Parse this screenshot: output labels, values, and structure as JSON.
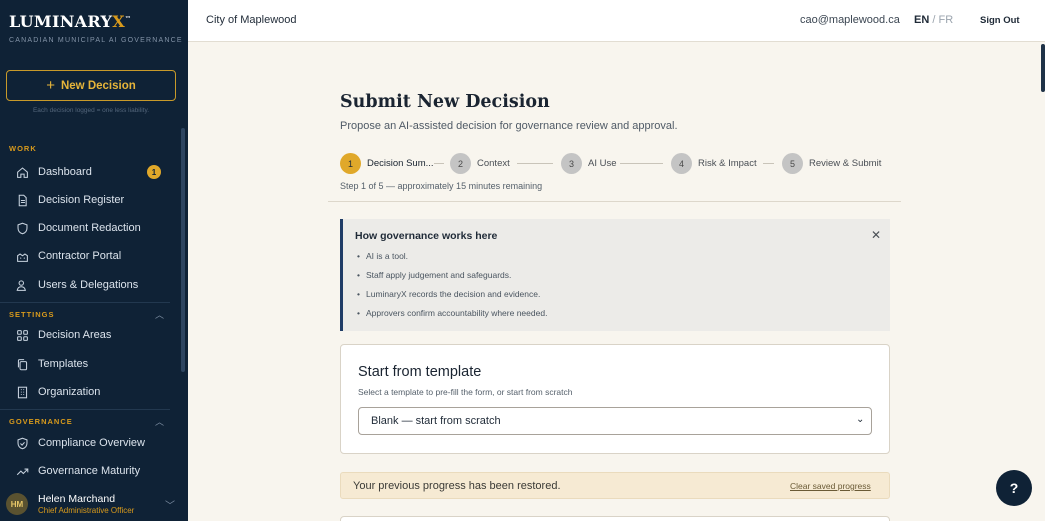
{
  "brand": {
    "name": "LUMINARY",
    "name_accent": "X",
    "tm": "™",
    "subtitle": "CANADIAN MUNICIPAL AI GOVERNANCE"
  },
  "sidebar": {
    "new_decision_label": "New Decision",
    "tagline": "Each decision logged = one less liability.",
    "sections": {
      "work": "WORK",
      "settings": "SETTINGS",
      "governance": "GOVERNANCE"
    },
    "work_items": [
      {
        "label": "Dashboard",
        "icon": "home-icon",
        "badge": "1"
      },
      {
        "label": "Decision Register",
        "icon": "document-icon"
      },
      {
        "label": "Document Redaction",
        "icon": "shield-icon"
      },
      {
        "label": "Contractor Portal",
        "icon": "building-icon"
      },
      {
        "label": "Users & Delegations",
        "icon": "users-icon"
      }
    ],
    "settings_items": [
      {
        "label": "Decision Areas",
        "icon": "grid-icon"
      },
      {
        "label": "Templates",
        "icon": "copy-icon"
      },
      {
        "label": "Organization",
        "icon": "office-icon"
      }
    ],
    "governance_items": [
      {
        "label": "Compliance Overview",
        "icon": "shield-check-icon"
      },
      {
        "label": "Governance Maturity",
        "icon": "trend-icon"
      }
    ],
    "user": {
      "initials": "HM",
      "name": "Helen Marchand",
      "role": "Chief Administrative Officer"
    }
  },
  "topbar": {
    "org_name": "City of Maplewood",
    "email": "cao@maplewood.ca",
    "lang_en": "EN",
    "lang_sep": "/",
    "lang_fr": "FR",
    "sign_out": "Sign Out"
  },
  "main": {
    "title": "Submit New Decision",
    "subtitle": "Propose an AI-assisted decision for governance review and approval.",
    "steps": [
      {
        "num": "1",
        "label": "Decision Sum..."
      },
      {
        "num": "2",
        "label": "Context"
      },
      {
        "num": "3",
        "label": "AI Use"
      },
      {
        "num": "4",
        "label": "Risk & Impact"
      },
      {
        "num": "5",
        "label": "Review & Submit"
      }
    ],
    "current_step": 1,
    "step_info": "Step 1 of 5 — approximately 15 minutes remaining",
    "info_box": {
      "title": "How governance works here",
      "close": "✕",
      "bullets": [
        "AI is a tool.",
        "Staff apply judgement and safeguards.",
        "LuminaryX records the decision and evidence.",
        "Approvers confirm accountability where needed."
      ]
    },
    "template": {
      "title": "Start from template",
      "subtitle": "Select a template to pre-fill the form, or start from scratch",
      "selected": "Blank — start from scratch"
    },
    "restored": {
      "message": "Your previous progress has been restored.",
      "clear_link": "Clear saved progress"
    },
    "help": "?"
  },
  "colors": {
    "sidebar_bg": "#0f2236",
    "accent_gold": "#e0a82a",
    "page_bg": "#f8f5ee",
    "info_border": "#1f3c66"
  }
}
